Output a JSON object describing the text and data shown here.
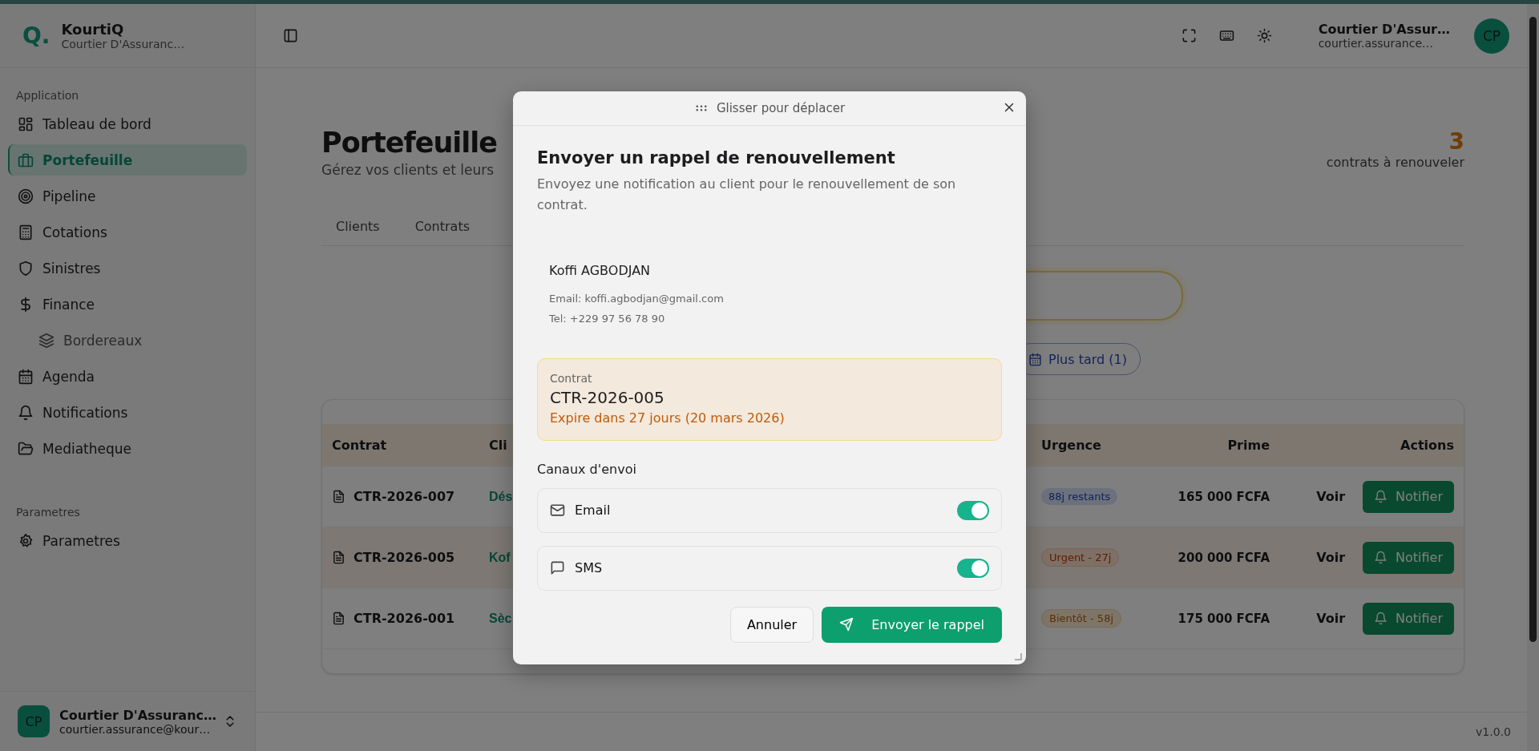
{
  "app": {
    "name": "KourtiQ",
    "logo": "Q.",
    "subtitle": "Courtier D'Assuranc…"
  },
  "sidebar": {
    "sections": [
      {
        "title": "Application",
        "items": [
          {
            "label": "Tableau de bord",
            "selected": false
          },
          {
            "label": "Portefeuille",
            "selected": true
          },
          {
            "label": "Pipeline",
            "selected": false
          },
          {
            "label": "Cotations",
            "selected": false
          },
          {
            "label": "Sinistres",
            "selected": false
          },
          {
            "label": "Finance",
            "selected": false,
            "children": [
              {
                "label": "Bordereaux",
                "selected": false
              }
            ]
          },
          {
            "label": "Agenda",
            "selected": false
          },
          {
            "label": "Notifications",
            "selected": false
          },
          {
            "label": "Mediatheque",
            "selected": false
          }
        ]
      },
      {
        "title": "Parametres",
        "items": [
          {
            "label": "Parametres",
            "selected": false
          }
        ]
      }
    ]
  },
  "sidebar_user": {
    "initials": "CP",
    "name": "Courtier D'Assuranc…",
    "email": "courtier.assurance@kour…"
  },
  "header": {
    "initials": "CP",
    "user_name": "Courtier D'Assur…",
    "user_email": "courtier.assurance…"
  },
  "page": {
    "title": "Portefeuille",
    "subtitle": "Gérez vos clients et leurs",
    "stat_value": "3",
    "stat_label": "contrats à renouveler"
  },
  "tabs": [
    {
      "label": "Clients",
      "selected": false
    },
    {
      "label": "Contrats",
      "selected": false
    }
  ],
  "filter_button": {
    "label": "Plus tard (1)"
  },
  "table": {
    "columns": [
      "Contrat",
      "Cli",
      "Urgence",
      "Prime",
      "Actions"
    ],
    "rows": [
      {
        "contract": "CTR-2026-007",
        "client": "Dés",
        "urgency": "88j restants",
        "kind": "info",
        "premium": "165 000 FCFA",
        "view": "Voir",
        "action": "Notifier",
        "highlighted": false
      },
      {
        "contract": "CTR-2026-005",
        "client": "Kof",
        "urgency": "Urgent - 27j",
        "kind": "urgent",
        "premium": "200 000 FCFA",
        "view": "Voir",
        "action": "Notifier",
        "highlighted": true
      },
      {
        "contract": "CTR-2026-001",
        "client": "Sèc",
        "urgency": "Bientôt - 58j",
        "kind": "soon",
        "premium": "175 000 FCFA",
        "view": "Voir",
        "action": "Notifier",
        "highlighted": false
      }
    ]
  },
  "modal": {
    "drag_label": "Glisser pour déplacer",
    "title": "Envoyer un rappel de renouvellement",
    "description": "Envoyez une notification au client pour le renouvellement de son contrat.",
    "client": {
      "name": "Koffi AGBODJAN",
      "email": "Email: koffi.agbodjan@gmail.com",
      "phone": "Tel: +229 97 56 78 90"
    },
    "contract": {
      "label": "Contrat",
      "number": "CTR-2026-005",
      "expiry": "Expire dans 27 jours (20 mars 2026)"
    },
    "channels_title": "Canaux d'envoi",
    "channels": [
      {
        "label": "Email",
        "on": true
      },
      {
        "label": "SMS",
        "on": true
      }
    ],
    "cancel": "Annuler",
    "submit": "Envoyer le rappel"
  },
  "footer": {
    "version": "v1.0.0"
  }
}
